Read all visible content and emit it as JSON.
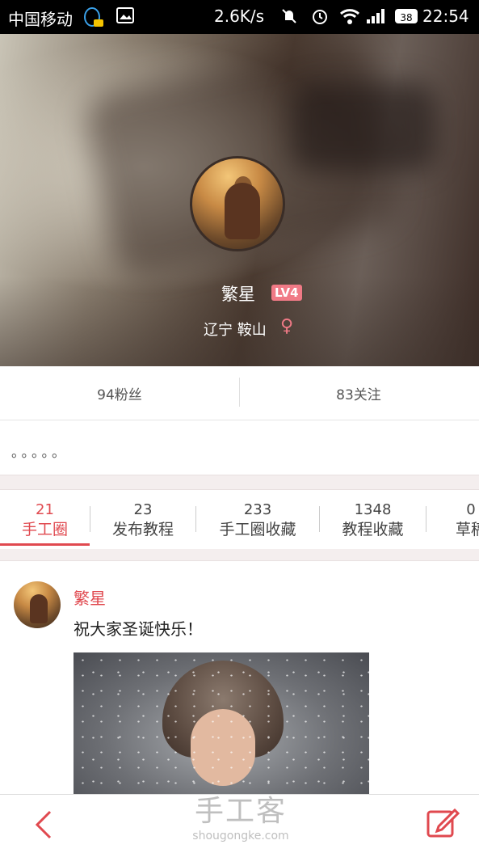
{
  "status_bar": {
    "carrier": "中国移动",
    "network_speed": "2.6K/s",
    "battery": "38",
    "time": "22:54"
  },
  "profile": {
    "name": "繁星",
    "level": "LV4",
    "location": "辽宁  鞍山",
    "gender_symbol": "♀"
  },
  "follow": {
    "fans": "94粉丝",
    "following": "83关注"
  },
  "bio": "。。。。。",
  "tabs": [
    {
      "count": "21",
      "label": "手工圈"
    },
    {
      "count": "23",
      "label": "发布教程"
    },
    {
      "count": "233",
      "label": "手工圈收藏"
    },
    {
      "count": "1348",
      "label": "教程收藏"
    },
    {
      "count": "0",
      "label": "草稿"
    }
  ],
  "post": {
    "author": "繁星",
    "text": "祝大家圣诞快乐！"
  },
  "watermark": {
    "cn": "手工客",
    "en": "shougongke.com"
  },
  "colors": {
    "accent": "#e0494f",
    "badge": "#f07a86"
  }
}
